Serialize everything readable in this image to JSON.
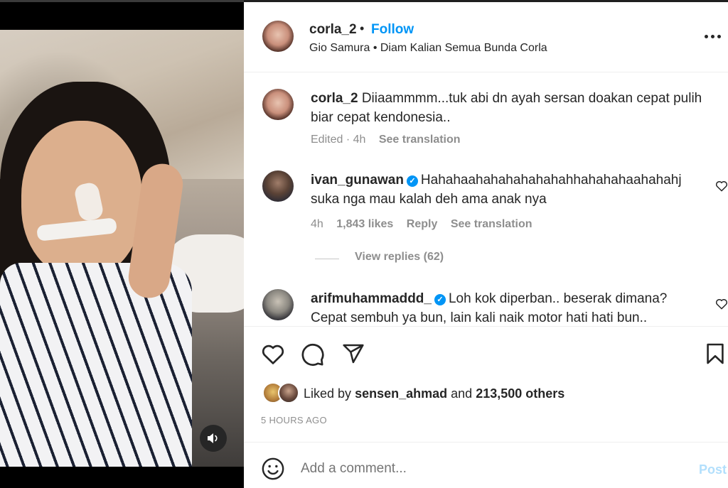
{
  "header": {
    "username": "corla_2",
    "separator": "•",
    "follow_label": "Follow",
    "subtitle": "Gio Samura • Diam Kalian Semua Bunda Corla"
  },
  "comments": [
    {
      "username": "corla_2",
      "text": "Diiaammmm...tuk abi dn ayah sersan doakan cepat pulih biar cepat kendonesia..",
      "meta": {
        "edited": "Edited · 4h",
        "translate": "See translation"
      }
    },
    {
      "username": "ivan_gunawan",
      "verified": true,
      "text": "Hahahaahahahahahahahhahahahaahahahj suka nga mau kalah deh ama anak nya",
      "meta": {
        "time": "4h",
        "likes": "1,843 likes",
        "reply": "Reply",
        "translate": "See translation"
      }
    },
    {
      "username": "arifmuhammaddd_",
      "verified": true,
      "text": "Loh kok diperban.. beserak dimana? Cepat sembuh ya bun, lain kali naik motor hati hati bun.."
    }
  ],
  "view_replies_label": "View replies (62)",
  "likes": {
    "prefix": "Liked by",
    "user": "sensen_ahmad",
    "middle": "and",
    "count": "213,500 others"
  },
  "time_ago": "5 HOURS AGO",
  "add_comment": {
    "placeholder": "Add a comment...",
    "post_label": "Post"
  },
  "colors": {
    "accent": "#0095f6",
    "post_disabled": "#b2dffc",
    "muted": "#8e8e8e"
  },
  "icons": [
    "heart-icon",
    "comment-icon",
    "share-icon",
    "bookmark-icon",
    "emoji-icon",
    "sound-icon",
    "more-icon",
    "verified-icon"
  ]
}
